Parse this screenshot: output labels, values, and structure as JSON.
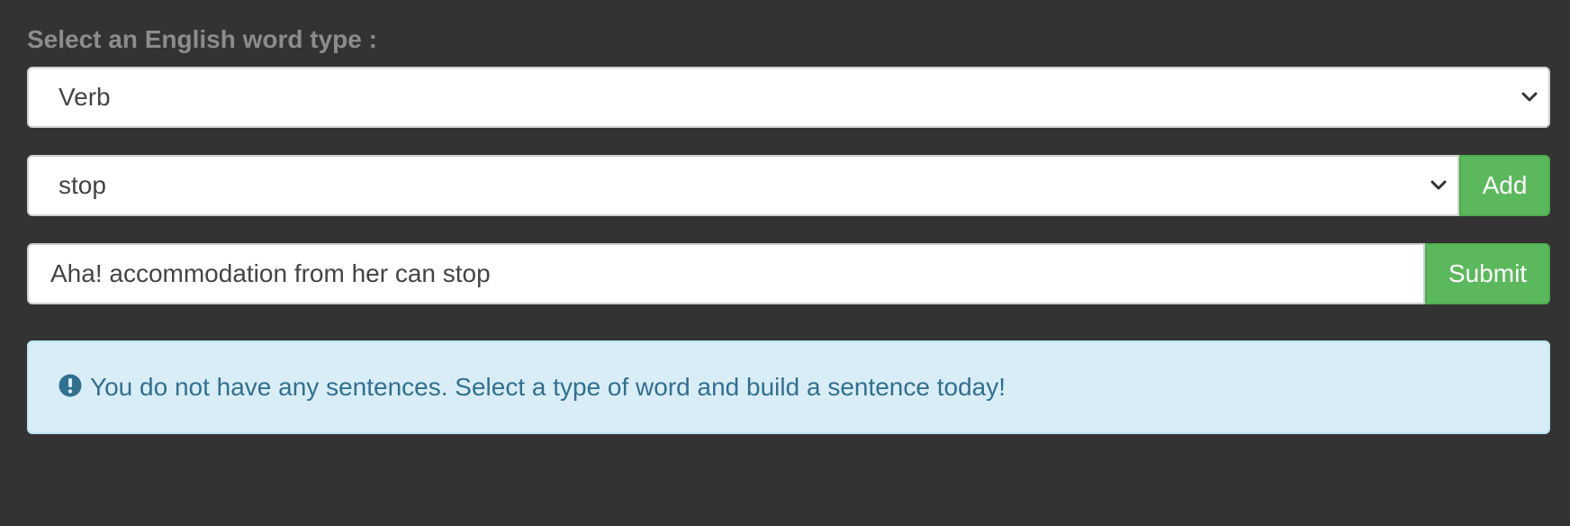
{
  "form": {
    "type_label": "Select an English word type :",
    "type_select": {
      "selected": "Verb",
      "icon": "chevron-down-icon"
    },
    "word_select": {
      "selected": "stop",
      "icon": "chevron-down-icon"
    },
    "add_button_label": "Add",
    "sentence_input": {
      "value": "Aha! accommodation from her can stop"
    },
    "submit_button_label": "Submit"
  },
  "alert": {
    "icon": "exclamation-circle-icon",
    "message": "You do not have any sentences. Select a type of word and build a sentence today!"
  },
  "colors": {
    "background": "#333333",
    "label": "#8c8c8c",
    "button_green": "#5cb85c",
    "alert_background": "#d9edf7",
    "alert_text": "#31708f"
  }
}
